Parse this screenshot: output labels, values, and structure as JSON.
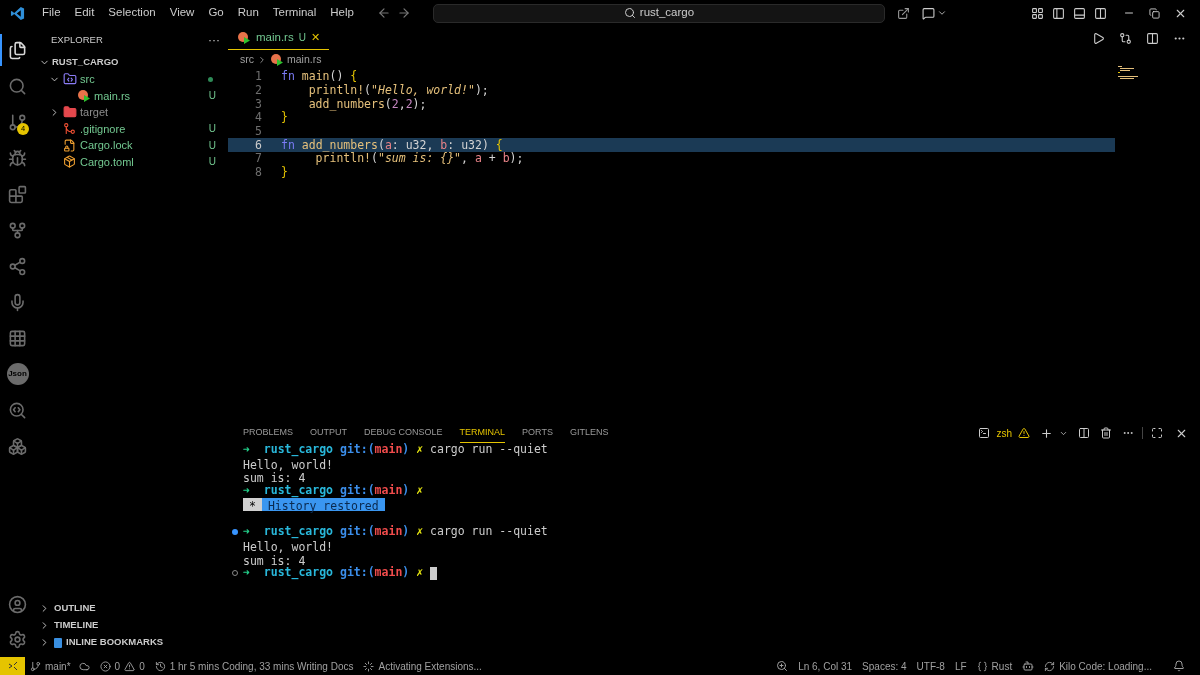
{
  "menu": [
    "File",
    "Edit",
    "Selection",
    "View",
    "Go",
    "Run",
    "Terminal",
    "Help"
  ],
  "search": {
    "value": "rust_cargo"
  },
  "activity_bar": [
    {
      "selected": true
    },
    {
      "selected": false
    },
    {
      "selected": false,
      "badge": "4"
    },
    {
      "selected": false
    },
    {
      "selected": false
    },
    {
      "selected": false
    },
    {
      "selected": false
    },
    {
      "selected": false
    },
    {
      "selected": false
    },
    {
      "selected": false,
      "label": "Json"
    },
    {
      "selected": false
    },
    {
      "selected": false
    }
  ],
  "sidebar": {
    "title": "EXPLORER",
    "more": "···",
    "root": {
      "label": "RUST_CARGO",
      "expanded": true
    },
    "tree": [
      {
        "name": "src",
        "kind": "folder",
        "expanded": true,
        "changes": true,
        "children": [
          {
            "name": "main.rs",
            "kind": "rust",
            "badge": "U"
          }
        ]
      },
      {
        "name": "target",
        "kind": "target-folder",
        "expanded": false,
        "ignored": true
      },
      {
        "name": ".gitignore",
        "kind": "git",
        "badge": "U"
      },
      {
        "name": "Cargo.lock",
        "kind": "lock",
        "badge": "U"
      },
      {
        "name": "Cargo.toml",
        "kind": "toml",
        "badge": "U"
      }
    ],
    "sections": [
      {
        "label": "OUTLINE",
        "expanded": false
      },
      {
        "label": "TIMELINE",
        "expanded": false
      },
      {
        "label": "INLINE BOOKMARKS",
        "expanded": false,
        "bookmark": true
      }
    ]
  },
  "editor": {
    "tabs": [
      {
        "label": "main.rs",
        "status": "U",
        "close": "✕",
        "selected": true
      }
    ],
    "breadcrumb": [
      "src",
      "main.rs"
    ],
    "lines": [
      {
        "number": "1",
        "current": false,
        "tokens": [
          {
            "text": "fn ",
            "kind": "keyword"
          },
          {
            "text": "main",
            "kind": "function"
          },
          {
            "text": "()",
            "kind": "paren"
          },
          {
            "text": " {",
            "kind": "brace"
          }
        ]
      },
      {
        "number": "2",
        "current": false,
        "tokens": [
          {
            "text": "    println!",
            "kind": "function"
          },
          {
            "text": "(",
            "kind": "paren"
          },
          {
            "text": "\"Hello, world!\"",
            "kind": "string"
          },
          {
            "text": ");",
            "kind": "paren"
          }
        ]
      },
      {
        "number": "3",
        "current": false,
        "tokens": [
          {
            "text": "    add_numbers",
            "kind": "function"
          },
          {
            "text": "(",
            "kind": "paren"
          },
          {
            "text": "2",
            "kind": "number"
          },
          {
            "text": ",",
            "kind": "paren"
          },
          {
            "text": "2",
            "kind": "number"
          },
          {
            "text": ");",
            "kind": "paren"
          }
        ]
      },
      {
        "number": "4",
        "current": false,
        "tokens": [
          {
            "text": "}",
            "kind": "brace"
          }
        ]
      },
      {
        "number": "5",
        "current": false
      },
      {
        "number": "6",
        "current": true,
        "tokens": [
          {
            "text": "fn ",
            "kind": "keyword"
          },
          {
            "text": "add_numbers",
            "kind": "function"
          },
          {
            "text": "(",
            "kind": "paren"
          },
          {
            "text": "a",
            "kind": "param"
          },
          {
            "text": ": ",
            "kind": "paren"
          },
          {
            "text": "u32",
            "kind": "type"
          },
          {
            "text": ", ",
            "kind": "paren"
          },
          {
            "text": "b",
            "kind": "param"
          },
          {
            "text": ": ",
            "kind": "paren"
          },
          {
            "text": "u32",
            "kind": "type"
          },
          {
            "text": ")",
            "kind": "paren"
          },
          {
            "text": " {",
            "kind": "brace"
          }
        ]
      },
      {
        "number": "7",
        "current": false,
        "tokens": [
          {
            "text": "     println!",
            "kind": "function"
          },
          {
            "text": "(",
            "kind": "paren"
          },
          {
            "text": "\"sum is: {}\"",
            "kind": "string"
          },
          {
            "text": ", ",
            "kind": "paren"
          },
          {
            "text": "a",
            "kind": "param"
          },
          {
            "text": " + ",
            "kind": "paren"
          },
          {
            "text": "b",
            "kind": "param"
          },
          {
            "text": ");",
            "kind": "paren"
          }
        ]
      },
      {
        "number": "8",
        "current": false,
        "tokens": [
          {
            "text": "}",
            "kind": "brace"
          }
        ]
      }
    ]
  },
  "panel": {
    "tabs": [
      {
        "label": "PROBLEMS",
        "selected": false
      },
      {
        "label": "OUTPUT",
        "selected": false
      },
      {
        "label": "DEBUG CONSOLE",
        "selected": false
      },
      {
        "label": "TERMINAL",
        "selected": true
      },
      {
        "label": "PORTS",
        "selected": false
      },
      {
        "label": "GITLENS",
        "selected": false
      }
    ],
    "shell": "zsh",
    "lines": [
      {
        "kind": "prompt",
        "decorated": false,
        "arrow": "➜",
        "dir": "rust_cargo",
        "git": "git:(",
        "branch": "main",
        "close": ")",
        "dirty": "✗",
        "command": "cargo run --quiet"
      },
      {
        "kind": "output",
        "text": "Hello, world!"
      },
      {
        "kind": "output",
        "text": "sum is: 4"
      },
      {
        "kind": "prompt",
        "decorated": false,
        "arrow": "➜",
        "dir": "rust_cargo",
        "git": "git:(",
        "branch": "main",
        "close": ")",
        "dirty": "✗"
      },
      {
        "kind": "banner",
        "star": "*",
        "text": "History restored"
      },
      {
        "kind": "blank"
      },
      {
        "kind": "prompt",
        "decorated": true,
        "succeeded": true,
        "arrow": "➜",
        "dir": "rust_cargo",
        "git": "git:(",
        "branch": "main",
        "close": ")",
        "dirty": "✗",
        "command": "cargo run --quiet"
      },
      {
        "kind": "output",
        "text": "Hello, world!"
      },
      {
        "kind": "output",
        "text": "sum is: 4"
      },
      {
        "kind": "prompt",
        "decorated": true,
        "succeeded": false,
        "arrow": "➜",
        "dir": "rust_cargo",
        "git": "git:(",
        "branch": "main",
        "close": ")",
        "dirty": "✗",
        "cursor": true
      }
    ]
  },
  "status_bar": {
    "left": [
      {
        "kind": "branch",
        "text": "main*"
      },
      {
        "kind": "problems",
        "errors": "0",
        "warnings": "0"
      },
      {
        "kind": "history",
        "text": "1 hr 5 mins Coding, 33 mins Writing Docs"
      },
      {
        "kind": "spinner",
        "text": "Activating Extensions..."
      }
    ],
    "right": [
      {
        "kind": "zoom"
      },
      {
        "kind": "text",
        "text": "Ln 6, Col 31"
      },
      {
        "kind": "text",
        "text": "Spaces: 4"
      },
      {
        "kind": "text",
        "text": "UTF-8"
      },
      {
        "kind": "text",
        "text": "LF"
      },
      {
        "kind": "language",
        "text": "Rust"
      },
      {
        "kind": "copilot"
      },
      {
        "kind": "sync",
        "text": "Kilo Code: Loading..."
      },
      {
        "kind": "bell"
      }
    ]
  }
}
